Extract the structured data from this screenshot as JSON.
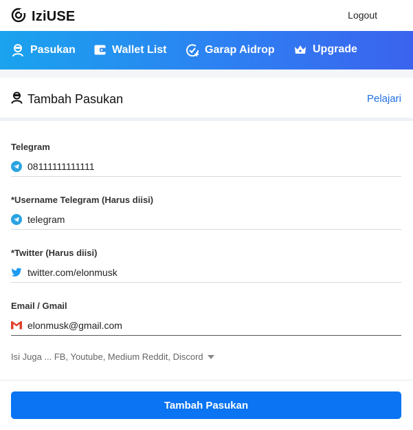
{
  "app": {
    "title": "IziUSE"
  },
  "topbar": {
    "logout_label": "Logout"
  },
  "nav": {
    "items": [
      {
        "label": "Pasukan",
        "icon": "user-badge-icon"
      },
      {
        "label": "Wallet List",
        "icon": "wallet-icon"
      },
      {
        "label": "Garap Aidrop",
        "icon": "check-plus-icon"
      },
      {
        "label": "Upgrade",
        "icon": "crown-icon"
      }
    ]
  },
  "page": {
    "title": "Tambah Pasukan",
    "learn_label": "Pelajari"
  },
  "form": {
    "telegram": {
      "label": "Telegram",
      "value": "08111111111111",
      "icon": "telegram-icon"
    },
    "username": {
      "label": "*Username Telegram (Harus diisi)",
      "value": "telegram",
      "icon": "telegram-icon"
    },
    "twitter": {
      "label": "*Twitter (Harus diisi)",
      "value": "twitter.com/elonmusk",
      "icon": "twitter-icon"
    },
    "email": {
      "label": "Email / Gmail",
      "value": "elonmusk@gmail.com",
      "icon": "gmail-icon"
    },
    "more_label": "Isi Juga ... FB, Youtube, Medium Reddit, Discord",
    "submit_label": "Tambah Pasukan"
  },
  "colors": {
    "accent": "#0a74f2",
    "link": "#1f6fe0",
    "nav_start": "#1aa3ee",
    "nav_end": "#3b63ee"
  }
}
